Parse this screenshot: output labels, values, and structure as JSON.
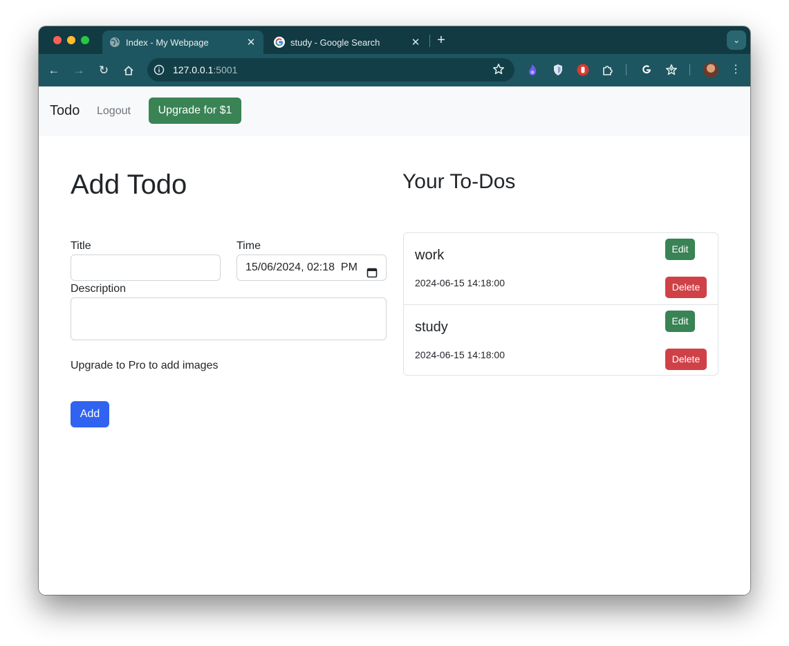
{
  "browser": {
    "tabs": [
      {
        "title": "Index - My Webpage",
        "active": true,
        "icon": "globe-icon"
      },
      {
        "title": "study - Google Search",
        "active": false,
        "icon": "google-icon"
      }
    ],
    "url_host": "127.0.0.1",
    "url_port": ":5001",
    "new_tab_label": "+",
    "colors": {
      "tab_strip": "#113a42",
      "toolbar": "#1d5660",
      "omnibox": "#123f47"
    }
  },
  "navbar": {
    "brand": "Todo",
    "logout": "Logout",
    "upgrade": "Upgrade for $1"
  },
  "form": {
    "heading": "Add Todo",
    "title_label": "Title",
    "title_value": "",
    "time_label": "Time",
    "time_value": "15/06/2024, 02:18  PM",
    "description_label": "Description",
    "description_value": "",
    "upgrade_note": "Upgrade to Pro to add images",
    "add_button": "Add"
  },
  "todos": {
    "heading": "Your To-Dos",
    "items": [
      {
        "title": "work",
        "time": "2024-06-15 14:18:00",
        "edit": "Edit",
        "delete": "Delete"
      },
      {
        "title": "study",
        "time": "2024-06-15 14:18:00",
        "edit": "Edit",
        "delete": "Delete"
      }
    ]
  },
  "colors": {
    "success": "#398355",
    "primary": "#2f63f0",
    "danger": "#cf4147",
    "navbar_bg": "#f8f9fa"
  }
}
